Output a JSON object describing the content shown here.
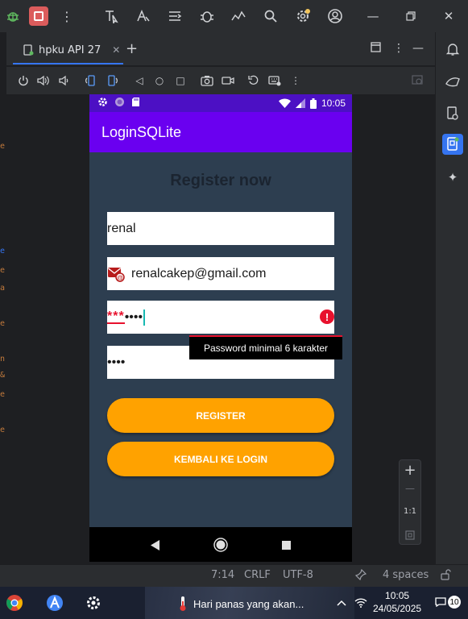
{
  "ide": {
    "tab_title": "hpku API 27",
    "tab_close": "✕",
    "tab_add": "+",
    "zoom": {
      "in": "+",
      "out": "—",
      "ratio": "1:1"
    },
    "status": {
      "position": "7:14",
      "line_ending": "CRLF",
      "encoding": "UTF-8",
      "indent": "4 spaces"
    }
  },
  "phone": {
    "status_time": "10:05",
    "app_title": "LoginSQLite",
    "form_title": "Register now",
    "name_value": "renal",
    "email_value": "renalcakep@gmail.com",
    "password_red": "***",
    "password_rest": "••••",
    "confirm_value": "••••",
    "error_message": "Password minimal 6 karakter",
    "error_glyph": "!",
    "register_label": "REGISTER",
    "back_label": "KEMBALI KE LOGIN"
  },
  "taskbar": {
    "weather_text": "Hari panas yang akan...",
    "time": "10:05",
    "date": "24/05/2025",
    "notif_count": "10"
  },
  "colors": {
    "status_bar": "#4c10c4",
    "app_bar": "#6a00f0",
    "screen_bg": "#2d3e50",
    "button": "#ffa200",
    "error": "#e8112d",
    "accent": "#3574f0"
  },
  "icons": {
    "toolbar": [
      "bug-icon",
      "stop-icon",
      "more-icon",
      "select-icon",
      "translate-icon",
      "list-icon",
      "debug-icon",
      "profiler-icon",
      "search-icon",
      "settings-icon",
      "account-icon"
    ],
    "right_strip": [
      "notifications-icon",
      "device-manager-icon",
      "logcat-icon",
      "running-devices-icon",
      "ai-assistant-icon"
    ]
  }
}
